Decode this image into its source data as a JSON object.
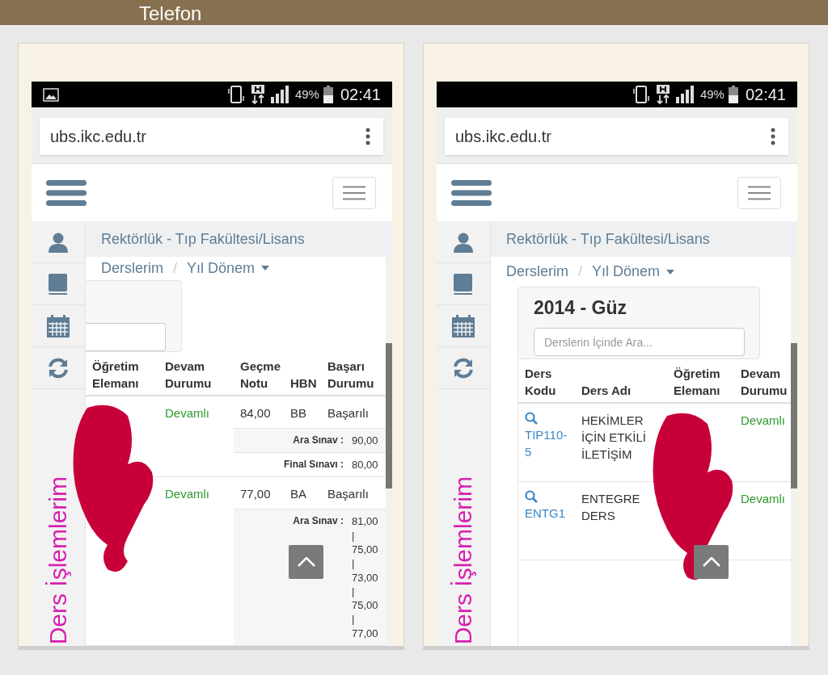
{
  "banner": {
    "title": "Telefon"
  },
  "phones": [
    {
      "status_bar": {
        "image_notification": true,
        "battery": "49%",
        "time": "02:41"
      },
      "url": "ubs.ikc.edu.tr",
      "header": "Rektörlük - Tıp Fakültesi/Lisans",
      "breadcrumb": {
        "items": [
          "Derslerim",
          "Yıl Dönem"
        ],
        "separator": "/"
      },
      "sidebar_label": "Ders İşlemlerim",
      "term_card": {
        "kind": "partial"
      },
      "table": {
        "columns": [
          "Öğretim Elemanı",
          "Devam Durumu",
          "Geçme Notu",
          "HBN",
          "Başarı Durumu"
        ],
        "rows": [
          {
            "cells": [
              {
                "kind": "hidden"
              },
              {
                "kind": "status",
                "text": "Devamlı"
              },
              {
                "kind": "plain",
                "text": "84,00"
              },
              {
                "kind": "plain",
                "text": "BB"
              },
              {
                "kind": "plain",
                "text": "Başarılı"
              }
            ],
            "details": [
              {
                "label": "Ara Sınav :",
                "value": "90,00"
              },
              {
                "label": "Final Sınavı :",
                "value": "80,00"
              }
            ]
          },
          {
            "cells": [
              {
                "kind": "hidden"
              },
              {
                "kind": "status",
                "text": "Devamlı"
              },
              {
                "kind": "plain",
                "text": "77,00"
              },
              {
                "kind": "plain",
                "text": "BA"
              },
              {
                "kind": "plain",
                "text": "Başarılı"
              }
            ],
            "details": [
              {
                "label": "Ara Sınav :",
                "value": "81,00 | 75,00 | 73,00 | 75,00 | 77,00"
              }
            ]
          }
        ]
      }
    },
    {
      "status_bar": {
        "image_notification": false,
        "battery": "49%",
        "time": "02:41"
      },
      "url": "ubs.ikc.edu.tr",
      "header": "Rektörlük - Tıp Fakültesi/Lisans",
      "breadcrumb": {
        "items": [
          "Derslerim",
          "Yıl Dönem"
        ],
        "separator": "/"
      },
      "sidebar_label": "Ders İşlemlerim",
      "term_card": {
        "kind": "full",
        "title": "2014 - Güz",
        "placeholder": "Derslerin İçinde Ara..."
      },
      "table": {
        "columns": [
          "Ders Kodu",
          "Ders Adı",
          "Öğretim Elemanı",
          "Devam Durumu"
        ],
        "rows": [
          {
            "cells": [
              {
                "kind": "link",
                "text": "TIP110-5"
              },
              {
                "kind": "plain",
                "text": "HEKİMLER İÇİN ETKİLİ İLETİŞİM"
              },
              {
                "kind": "hidden"
              },
              {
                "kind": "status",
                "text": "Devamlı"
              }
            ]
          },
          {
            "cells": [
              {
                "kind": "link",
                "text": "ENTG1"
              },
              {
                "kind": "plain",
                "text": "ENTEGRE DERS"
              },
              {
                "kind": "hidden"
              },
              {
                "kind": "status",
                "text": "Devamlı"
              }
            ]
          }
        ]
      }
    }
  ]
}
